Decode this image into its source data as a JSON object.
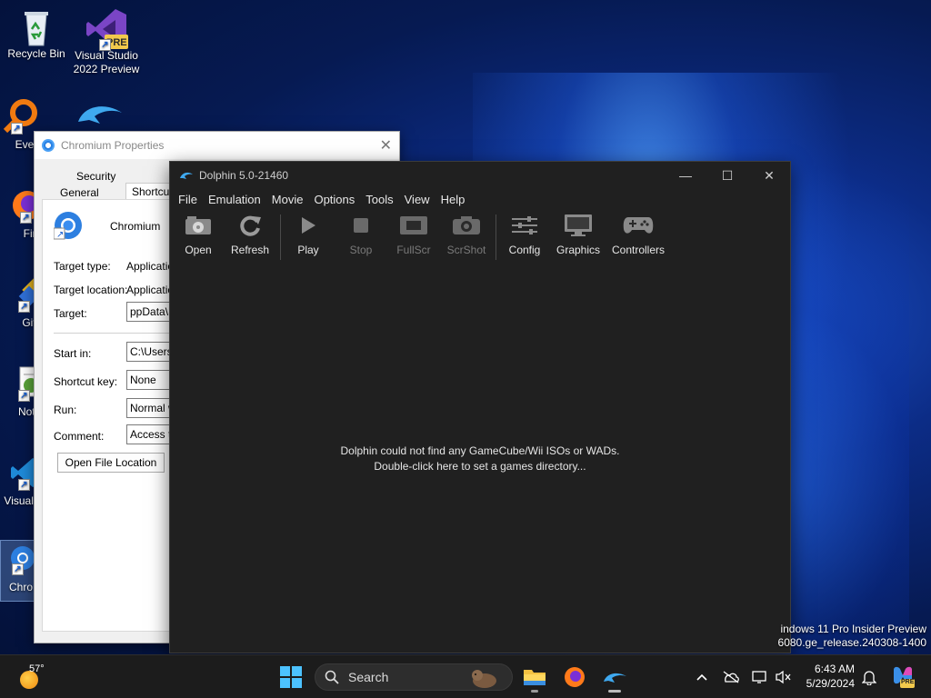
{
  "desktop": {
    "icons": [
      {
        "label": "Recycle Bin"
      },
      {
        "label": "Visual Studio 2022 Preview",
        "badge": "PRE"
      },
      {
        "label": "Every"
      },
      {
        "label": "Fire"
      },
      {
        "label": "Git"
      },
      {
        "label": "Notep"
      },
      {
        "label": "Visual Co"
      },
      {
        "label": "Chro"
      }
    ],
    "watermark": {
      "line1": "indows 11 Pro Insider Preview",
      "line2": "6080.ge_release.240308-1400"
    }
  },
  "properties_dialog": {
    "title": "Chromium Properties",
    "close_glyph": "✕",
    "tabs": {
      "security": "Security",
      "general": "General",
      "shortcut": "Shortcut"
    },
    "app_name": "Chromium",
    "fields": {
      "target_type_label": "Target type:",
      "target_type_value": "Application",
      "target_location_label": "Target location:",
      "target_location_value": "Application",
      "target_label": "Target:",
      "target_value": "ppData\\Lo",
      "start_in_label": "Start in:",
      "start_in_value": "C:\\Users\\",
      "shortcut_key_label": "Shortcut key:",
      "shortcut_key_value": "None",
      "run_label": "Run:",
      "run_value": "Normal wi",
      "comment_label": "Comment:",
      "comment_value": "Access th"
    },
    "open_file_location": "Open File Location"
  },
  "dolphin": {
    "title": "Dolphin 5.0-21460",
    "window_controls": {
      "minimize": "—",
      "maximize": "☐",
      "close": "✕"
    },
    "menu": [
      "File",
      "Emulation",
      "Movie",
      "Options",
      "Tools",
      "View",
      "Help"
    ],
    "toolbar": {
      "open": "Open",
      "refresh": "Refresh",
      "play": "Play",
      "stop": "Stop",
      "fullscr": "FullScr",
      "scrshot": "ScrShot",
      "config": "Config",
      "graphics": "Graphics",
      "controllers": "Controllers"
    },
    "message_line1": "Dolphin could not find any GameCube/Wii ISOs or WADs.",
    "message_line2": "Double-click here to set a games directory..."
  },
  "taskbar": {
    "weather_temp": "57°",
    "search_label": "Search",
    "time": "6:43 AM",
    "date": "5/29/2024",
    "copilot_badge": "PRE"
  },
  "colors": {
    "dolphin_bg": "#202020",
    "taskbar_bg": "#1c1c1c",
    "desktop_blue": "#1f5ad8"
  }
}
